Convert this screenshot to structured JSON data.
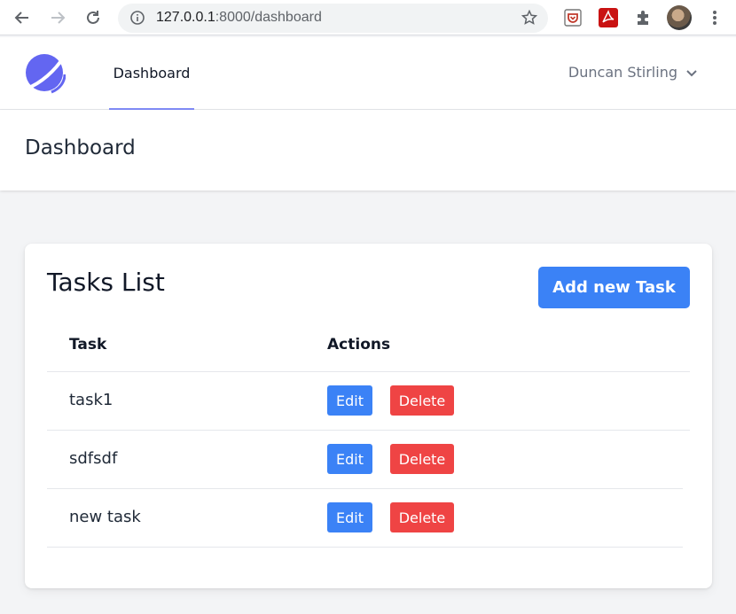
{
  "browser": {
    "url_host": "127.0.0.1",
    "url_rest": ":8000/dashboard",
    "icons": [
      "back-arrow-icon",
      "forward-arrow-icon",
      "reload-icon",
      "info-icon",
      "star-icon",
      "pocket-extension-icon",
      "pdf-extension-icon",
      "extensions-puzzle-icon",
      "profile-avatar",
      "more-vert-icon"
    ]
  },
  "header": {
    "nav_label": "Dashboard",
    "user_name": "Duncan Stirling"
  },
  "page": {
    "title": "Dashboard"
  },
  "card": {
    "title": "Tasks List",
    "add_button": "Add new Task",
    "columns": [
      "Task",
      "Actions"
    ],
    "rows": [
      {
        "task": "task1",
        "edit": "Edit",
        "delete": "Delete"
      },
      {
        "task": "sdfsdf",
        "edit": "Edit",
        "delete": "Delete"
      },
      {
        "task": "new task",
        "edit": "Edit",
        "delete": "Delete"
      }
    ]
  },
  "colors": {
    "primary": "#3b82f6",
    "danger": "#ef4444",
    "accent": "#818cf8",
    "background": "#f3f4f6"
  }
}
